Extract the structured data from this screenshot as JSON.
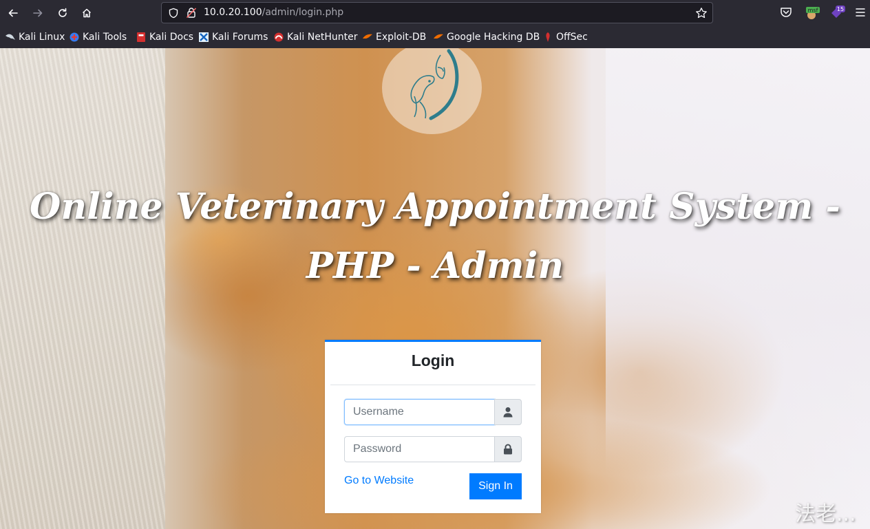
{
  "browser": {
    "url_host": "10.0.20.100",
    "url_path": "/admin/login.php",
    "bookmarks": [
      {
        "label": "Kali Linux"
      },
      {
        "label": "Kali Tools"
      },
      {
        "label": "Kali Docs"
      },
      {
        "label": "Kali Forums"
      },
      {
        "label": "Kali NetHunter"
      },
      {
        "label": "Exploit-DB"
      },
      {
        "label": "Google Hacking DB"
      },
      {
        "label": "OffSec"
      }
    ],
    "extensions": {
      "msf_badge": "msf",
      "counter_badge": "15"
    }
  },
  "page": {
    "title": "Online Veterinary Appointment System - PHP - Admin",
    "login": {
      "heading": "Login",
      "username_placeholder": "Username",
      "password_placeholder": "Password",
      "go_link": "Go to Website",
      "signin_label": "Sign In"
    },
    "watermark": "法老..."
  },
  "colors": {
    "primary": "#007bff",
    "chrome_bg": "#2b2a33",
    "urlbar_bg": "#1c1b22"
  }
}
